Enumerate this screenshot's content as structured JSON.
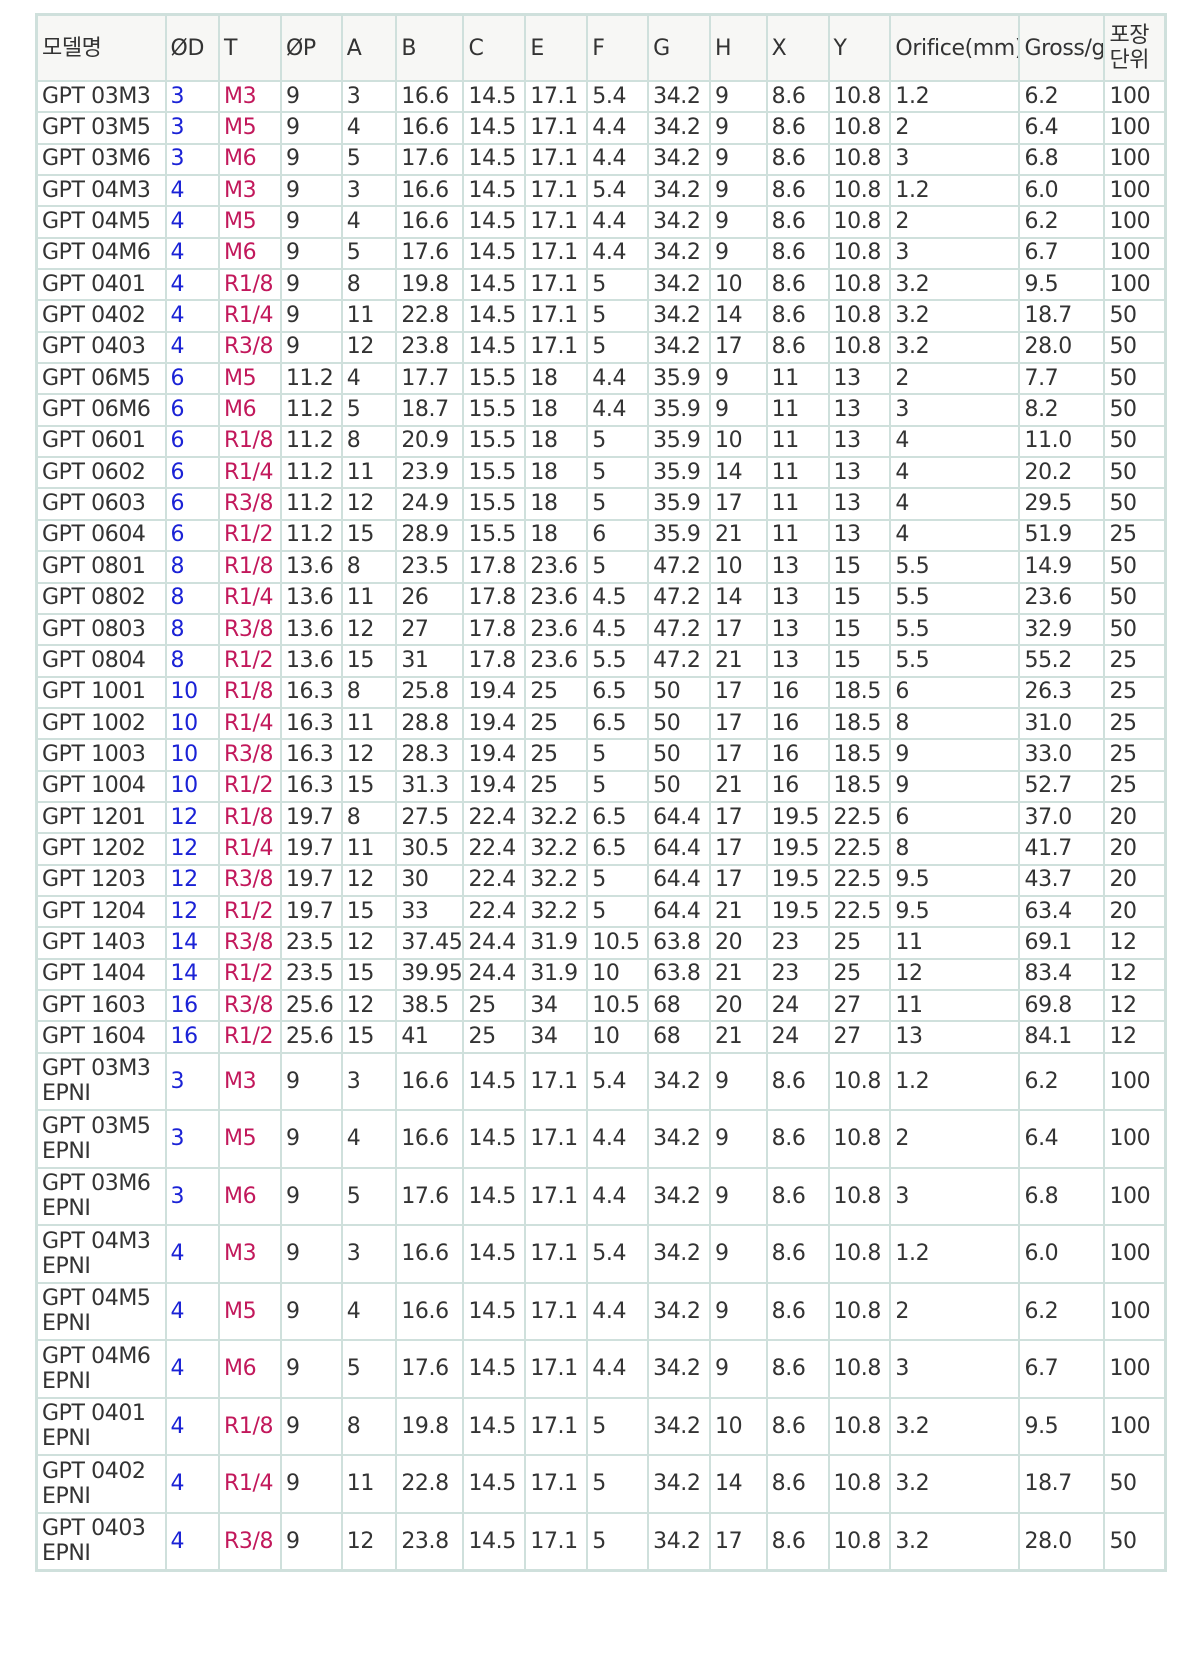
{
  "table": {
    "headers": [
      "모델명",
      "ØD",
      "T",
      "ØP",
      "A",
      "B",
      "C",
      "E",
      "F",
      "G",
      "H",
      "X",
      "Y",
      "Orifice(mm)",
      "Gross/g",
      "포장단위"
    ],
    "rows": [
      [
        "GPT 03M3",
        "3",
        "M3",
        "9",
        "3",
        "16.6",
        "14.5",
        "17.1",
        "5.4",
        "34.2",
        "9",
        "8.6",
        "10.8",
        "1.2",
        "6.2",
        "100"
      ],
      [
        "GPT 03M5",
        "3",
        "M5",
        "9",
        "4",
        "16.6",
        "14.5",
        "17.1",
        "4.4",
        "34.2",
        "9",
        "8.6",
        "10.8",
        "2",
        "6.4",
        "100"
      ],
      [
        "GPT 03M6",
        "3",
        "M6",
        "9",
        "5",
        "17.6",
        "14.5",
        "17.1",
        "4.4",
        "34.2",
        "9",
        "8.6",
        "10.8",
        "3",
        "6.8",
        "100"
      ],
      [
        "GPT 04M3",
        "4",
        "M3",
        "9",
        "3",
        "16.6",
        "14.5",
        "17.1",
        "5.4",
        "34.2",
        "9",
        "8.6",
        "10.8",
        "1.2",
        "6.0",
        "100"
      ],
      [
        "GPT 04M5",
        "4",
        "M5",
        "9",
        "4",
        "16.6",
        "14.5",
        "17.1",
        "4.4",
        "34.2",
        "9",
        "8.6",
        "10.8",
        "2",
        "6.2",
        "100"
      ],
      [
        "GPT 04M6",
        "4",
        "M6",
        "9",
        "5",
        "17.6",
        "14.5",
        "17.1",
        "4.4",
        "34.2",
        "9",
        "8.6",
        "10.8",
        "3",
        "6.7",
        "100"
      ],
      [
        "GPT 0401",
        "4",
        "R1/8",
        "9",
        "8",
        "19.8",
        "14.5",
        "17.1",
        "5",
        "34.2",
        "10",
        "8.6",
        "10.8",
        "3.2",
        "9.5",
        "100"
      ],
      [
        "GPT 0402",
        "4",
        "R1/4",
        "9",
        "11",
        "22.8",
        "14.5",
        "17.1",
        "5",
        "34.2",
        "14",
        "8.6",
        "10.8",
        "3.2",
        "18.7",
        "50"
      ],
      [
        "GPT 0403",
        "4",
        "R3/8",
        "9",
        "12",
        "23.8",
        "14.5",
        "17.1",
        "5",
        "34.2",
        "17",
        "8.6",
        "10.8",
        "3.2",
        "28.0",
        "50"
      ],
      [
        "GPT 06M5",
        "6",
        "M5",
        "11.2",
        "4",
        "17.7",
        "15.5",
        "18",
        "4.4",
        "35.9",
        "9",
        "11",
        "13",
        "2",
        "7.7",
        "50"
      ],
      [
        "GPT 06M6",
        "6",
        "M6",
        "11.2",
        "5",
        "18.7",
        "15.5",
        "18",
        "4.4",
        "35.9",
        "9",
        "11",
        "13",
        "3",
        "8.2",
        "50"
      ],
      [
        "GPT 0601",
        "6",
        "R1/8",
        "11.2",
        "8",
        "20.9",
        "15.5",
        "18",
        "5",
        "35.9",
        "10",
        "11",
        "13",
        "4",
        "11.0",
        "50"
      ],
      [
        "GPT 0602",
        "6",
        "R1/4",
        "11.2",
        "11",
        "23.9",
        "15.5",
        "18",
        "5",
        "35.9",
        "14",
        "11",
        "13",
        "4",
        "20.2",
        "50"
      ],
      [
        "GPT 0603",
        "6",
        "R3/8",
        "11.2",
        "12",
        "24.9",
        "15.5",
        "18",
        "5",
        "35.9",
        "17",
        "11",
        "13",
        "4",
        "29.5",
        "50"
      ],
      [
        "GPT 0604",
        "6",
        "R1/2",
        "11.2",
        "15",
        "28.9",
        "15.5",
        "18",
        "6",
        "35.9",
        "21",
        "11",
        "13",
        "4",
        "51.9",
        "25"
      ],
      [
        "GPT 0801",
        "8",
        "R1/8",
        "13.6",
        "8",
        "23.5",
        "17.8",
        "23.6",
        "5",
        "47.2",
        "10",
        "13",
        "15",
        "5.5",
        "14.9",
        "50"
      ],
      [
        "GPT 0802",
        "8",
        "R1/4",
        "13.6",
        "11",
        "26",
        "17.8",
        "23.6",
        "4.5",
        "47.2",
        "14",
        "13",
        "15",
        "5.5",
        "23.6",
        "50"
      ],
      [
        "GPT 0803",
        "8",
        "R3/8",
        "13.6",
        "12",
        "27",
        "17.8",
        "23.6",
        "4.5",
        "47.2",
        "17",
        "13",
        "15",
        "5.5",
        "32.9",
        "50"
      ],
      [
        "GPT 0804",
        "8",
        "R1/2",
        "13.6",
        "15",
        "31",
        "17.8",
        "23.6",
        "5.5",
        "47.2",
        "21",
        "13",
        "15",
        "5.5",
        "55.2",
        "25"
      ],
      [
        "GPT 1001",
        "10",
        "R1/8",
        "16.3",
        "8",
        "25.8",
        "19.4",
        "25",
        "6.5",
        "50",
        "17",
        "16",
        "18.5",
        "6",
        "26.3",
        "25"
      ],
      [
        "GPT 1002",
        "10",
        "R1/4",
        "16.3",
        "11",
        "28.8",
        "19.4",
        "25",
        "6.5",
        "50",
        "17",
        "16",
        "18.5",
        "8",
        "31.0",
        "25"
      ],
      [
        "GPT 1003",
        "10",
        "R3/8",
        "16.3",
        "12",
        "28.3",
        "19.4",
        "25",
        "5",
        "50",
        "17",
        "16",
        "18.5",
        "9",
        "33.0",
        "25"
      ],
      [
        "GPT 1004",
        "10",
        "R1/2",
        "16.3",
        "15",
        "31.3",
        "19.4",
        "25",
        "5",
        "50",
        "21",
        "16",
        "18.5",
        "9",
        "52.7",
        "25"
      ],
      [
        "GPT 1201",
        "12",
        "R1/8",
        "19.7",
        "8",
        "27.5",
        "22.4",
        "32.2",
        "6.5",
        "64.4",
        "17",
        "19.5",
        "22.5",
        "6",
        "37.0",
        "20"
      ],
      [
        "GPT 1202",
        "12",
        "R1/4",
        "19.7",
        "11",
        "30.5",
        "22.4",
        "32.2",
        "6.5",
        "64.4",
        "17",
        "19.5",
        "22.5",
        "8",
        "41.7",
        "20"
      ],
      [
        "GPT 1203",
        "12",
        "R3/8",
        "19.7",
        "12",
        "30",
        "22.4",
        "32.2",
        "5",
        "64.4",
        "17",
        "19.5",
        "22.5",
        "9.5",
        "43.7",
        "20"
      ],
      [
        "GPT 1204",
        "12",
        "R1/2",
        "19.7",
        "15",
        "33",
        "22.4",
        "32.2",
        "5",
        "64.4",
        "21",
        "19.5",
        "22.5",
        "9.5",
        "63.4",
        "20"
      ],
      [
        "GPT 1403",
        "14",
        "R3/8",
        "23.5",
        "12",
        "37.45",
        "24.4",
        "31.9",
        "10.5",
        "63.8",
        "20",
        "23",
        "25",
        "11",
        "69.1",
        "12"
      ],
      [
        "GPT 1404",
        "14",
        "R1/2",
        "23.5",
        "15",
        "39.95",
        "24.4",
        "31.9",
        "10",
        "63.8",
        "21",
        "23",
        "25",
        "12",
        "83.4",
        "12"
      ],
      [
        "GPT 1603",
        "16",
        "R3/8",
        "25.6",
        "12",
        "38.5",
        "25",
        "34",
        "10.5",
        "68",
        "20",
        "24",
        "27",
        "11",
        "69.8",
        "12"
      ],
      [
        "GPT 1604",
        "16",
        "R1/2",
        "25.6",
        "15",
        "41",
        "25",
        "34",
        "10",
        "68",
        "21",
        "24",
        "27",
        "13",
        "84.1",
        "12"
      ],
      [
        "GPT 03M3 EPNI",
        "3",
        "M3",
        "9",
        "3",
        "16.6",
        "14.5",
        "17.1",
        "5.4",
        "34.2",
        "9",
        "8.6",
        "10.8",
        "1.2",
        "6.2",
        "100"
      ],
      [
        "GPT 03M5 EPNI",
        "3",
        "M5",
        "9",
        "4",
        "16.6",
        "14.5",
        "17.1",
        "4.4",
        "34.2",
        "9",
        "8.6",
        "10.8",
        "2",
        "6.4",
        "100"
      ],
      [
        "GPT 03M6 EPNI",
        "3",
        "M6",
        "9",
        "5",
        "17.6",
        "14.5",
        "17.1",
        "4.4",
        "34.2",
        "9",
        "8.6",
        "10.8",
        "3",
        "6.8",
        "100"
      ],
      [
        "GPT 04M3 EPNI",
        "4",
        "M3",
        "9",
        "3",
        "16.6",
        "14.5",
        "17.1",
        "5.4",
        "34.2",
        "9",
        "8.6",
        "10.8",
        "1.2",
        "6.0",
        "100"
      ],
      [
        "GPT 04M5 EPNI",
        "4",
        "M5",
        "9",
        "4",
        "16.6",
        "14.5",
        "17.1",
        "4.4",
        "34.2",
        "9",
        "8.6",
        "10.8",
        "2",
        "6.2",
        "100"
      ],
      [
        "GPT 04M6 EPNI",
        "4",
        "M6",
        "9",
        "5",
        "17.6",
        "14.5",
        "17.1",
        "4.4",
        "34.2",
        "9",
        "8.6",
        "10.8",
        "3",
        "6.7",
        "100"
      ],
      [
        "GPT 0401 EPNI",
        "4",
        "R1/8",
        "9",
        "8",
        "19.8",
        "14.5",
        "17.1",
        "5",
        "34.2",
        "10",
        "8.6",
        "10.8",
        "3.2",
        "9.5",
        "100"
      ],
      [
        "GPT 0402 EPNI",
        "4",
        "R1/4",
        "9",
        "11",
        "22.8",
        "14.5",
        "17.1",
        "5",
        "34.2",
        "14",
        "8.6",
        "10.8",
        "3.2",
        "18.7",
        "50"
      ],
      [
        "GPT 0403 EPNI",
        "4",
        "R3/8",
        "9",
        "12",
        "23.8",
        "14.5",
        "17.1",
        "5",
        "34.2",
        "17",
        "8.6",
        "10.8",
        "3.2",
        "28.0",
        "50"
      ]
    ]
  },
  "colors": {
    "diameter": "#1a22d6",
    "thread": "#c2185b",
    "text": "#333333",
    "grid": "#cfe0dc",
    "header_bg": "#f7f7f5"
  }
}
